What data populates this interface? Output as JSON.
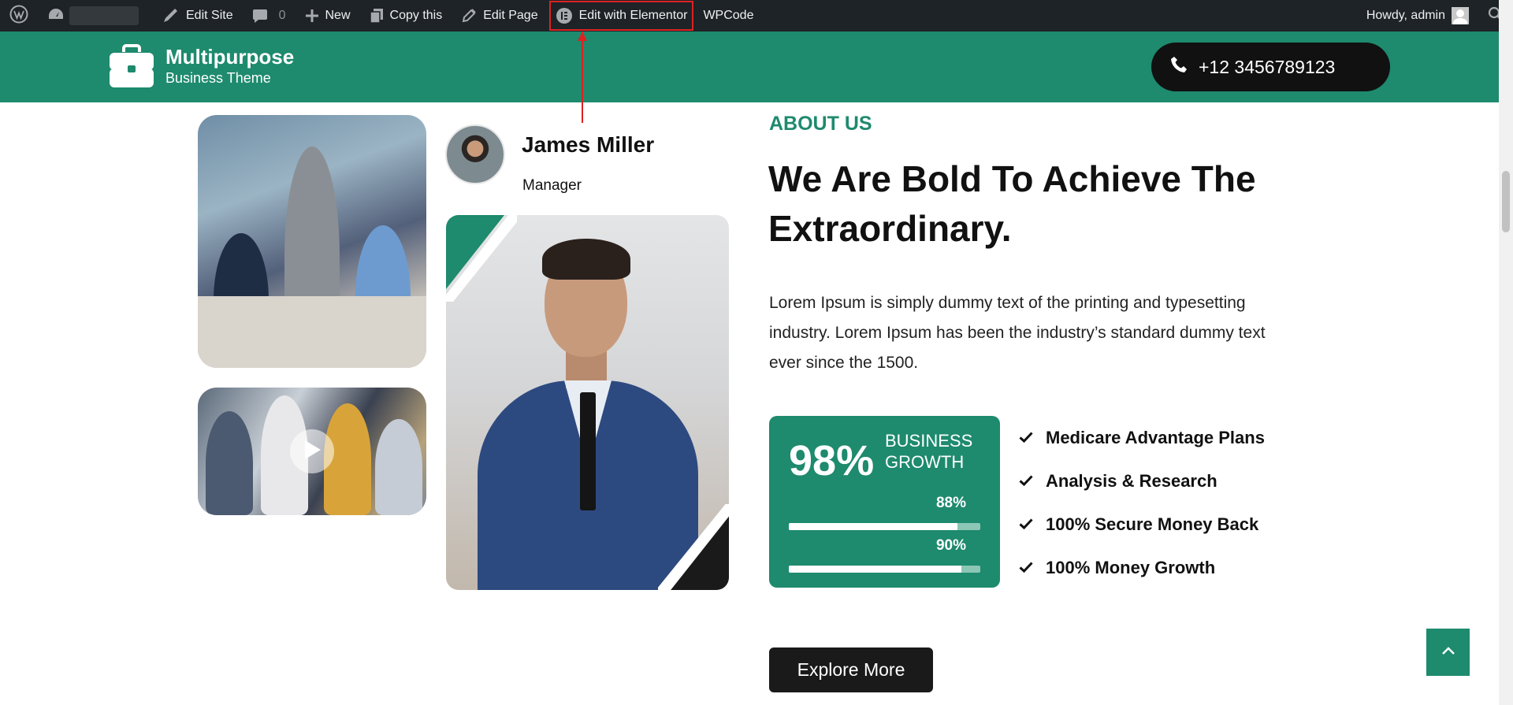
{
  "adminbar": {
    "edit_site": "Edit Site",
    "comments_count": "0",
    "new": "New",
    "copy_this": "Copy this",
    "edit_page": "Edit Page",
    "edit_with_elementor": "Edit with Elementor",
    "wpcode": "WPCode",
    "howdy": "Howdy, admin"
  },
  "header": {
    "logo_title": "Multipurpose",
    "logo_subtitle": "Business Theme",
    "phone": "+12 3456789123"
  },
  "team": {
    "name": "James Miller",
    "role": "Manager"
  },
  "about": {
    "label": "ABOUT US",
    "title": "We Are Bold To Achieve The Extraordinary.",
    "text": "Lorem Ipsum is simply dummy text of the printing and typesetting industry. Lorem Ipsum has been the industry’s standard dummy text ever since the 1500."
  },
  "stats": {
    "percent": "98%",
    "label": "BUSINESS GROWTH",
    "bar1_label": "88%",
    "bar1_value": 0.88,
    "bar2_label": "90%",
    "bar2_value": 0.9
  },
  "checklist": [
    "Medicare Advantage Plans",
    "Analysis & Research",
    "100% Secure Money Back",
    "100% Money Growth"
  ],
  "cta": {
    "explore": "Explore More"
  },
  "colors": {
    "brand_green": "#1e8a6e",
    "adminbar_bg": "#1d2327",
    "dark": "#1a1a1a",
    "highlight_red": "#dd2222"
  },
  "icons": {
    "wordpress": "wordpress-icon",
    "dashboard": "dashboard-icon",
    "brush": "brush-icon",
    "comment": "comment-icon",
    "plus": "plus-icon",
    "copy": "copy-icon",
    "pencil": "pencil-icon",
    "elementor": "elementor-icon",
    "search": "search-icon",
    "phone": "phone-icon",
    "briefcase": "briefcase-icon",
    "play": "play-icon",
    "check": "check-icon",
    "chevron_up": "chevron-up-icon"
  }
}
